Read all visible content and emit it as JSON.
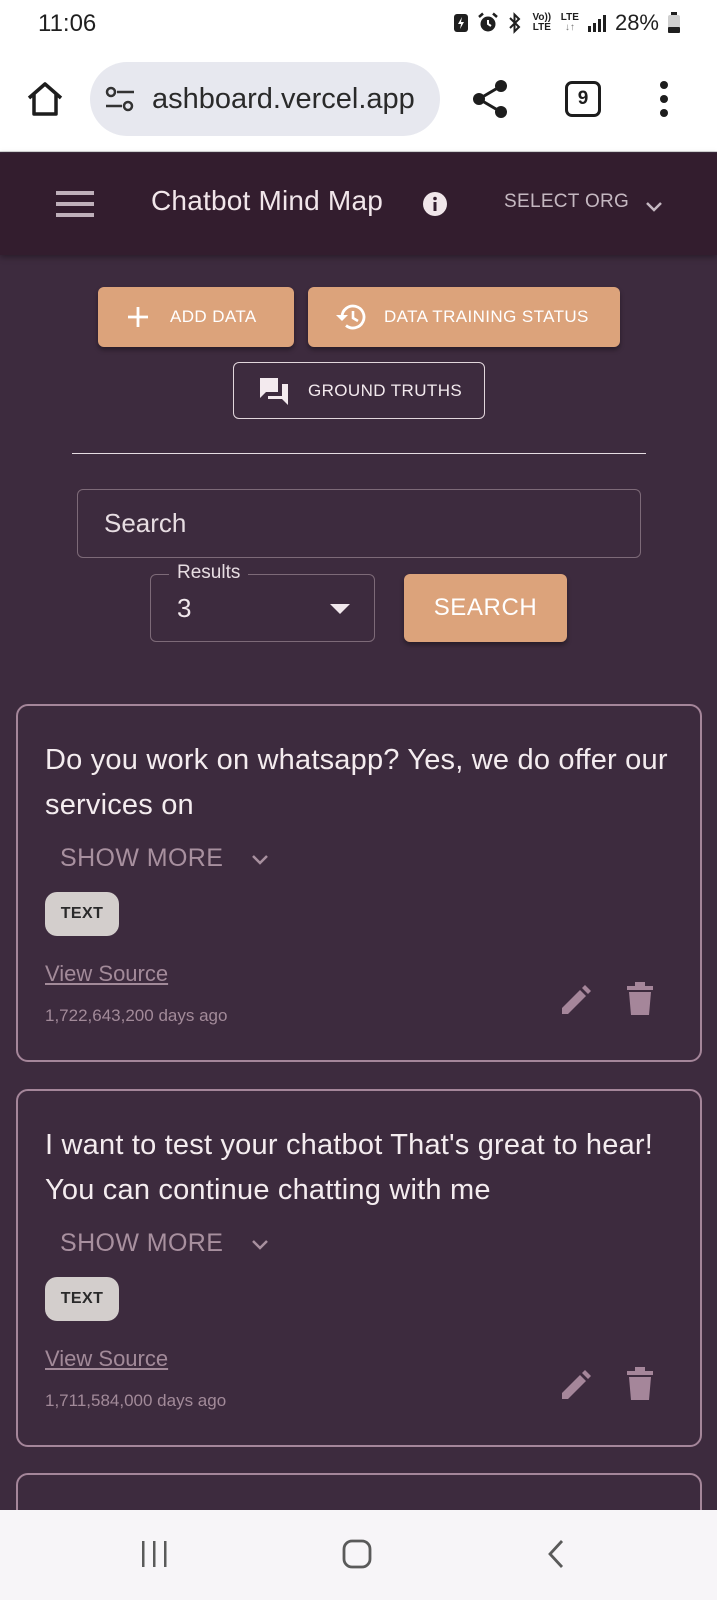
{
  "status_bar": {
    "time": "11:06",
    "volte_label": "Vo)) LTE",
    "lte_label": "LTE",
    "battery": "28%"
  },
  "browser": {
    "url": "ashboard.vercel.app",
    "tab_count": "9"
  },
  "app": {
    "title": "Chatbot Mind Map",
    "org_select": "SELECT ORG"
  },
  "actions": {
    "add_data": "ADD DATA",
    "training_status": "DATA TRAINING STATUS",
    "ground_truths": "GROUND TRUTHS"
  },
  "search": {
    "placeholder": "Search",
    "results_label": "Results",
    "results_value": "3",
    "button": "SEARCH"
  },
  "cards": [
    {
      "text": "Do you work on whatsapp? Yes, we do offer our services on",
      "show_more": "SHOW MORE",
      "chip": "TEXT",
      "source": "View Source",
      "age": "1,722,643,200 days ago"
    },
    {
      "text": "I want to test your chatbot That's great to hear! You can continue chatting with me",
      "show_more": "SHOW MORE",
      "chip": "TEXT",
      "source": "View Source",
      "age": "1,711,584,000 days ago"
    }
  ],
  "colors": {
    "page_bg": "#3d2b3e",
    "header_bg": "#331d2e",
    "accent": "#dca37b",
    "card_border": "#a5869a",
    "muted_text": "#a28a99"
  },
  "icons": [
    "home-icon",
    "tune-icon",
    "share-icon",
    "more-vert-icon",
    "menu-icon",
    "info-icon",
    "chevron-down-icon",
    "plus-icon",
    "history-icon",
    "forum-icon",
    "edit-icon",
    "delete-icon",
    "recents-icon",
    "home-nav-icon",
    "back-icon"
  ]
}
